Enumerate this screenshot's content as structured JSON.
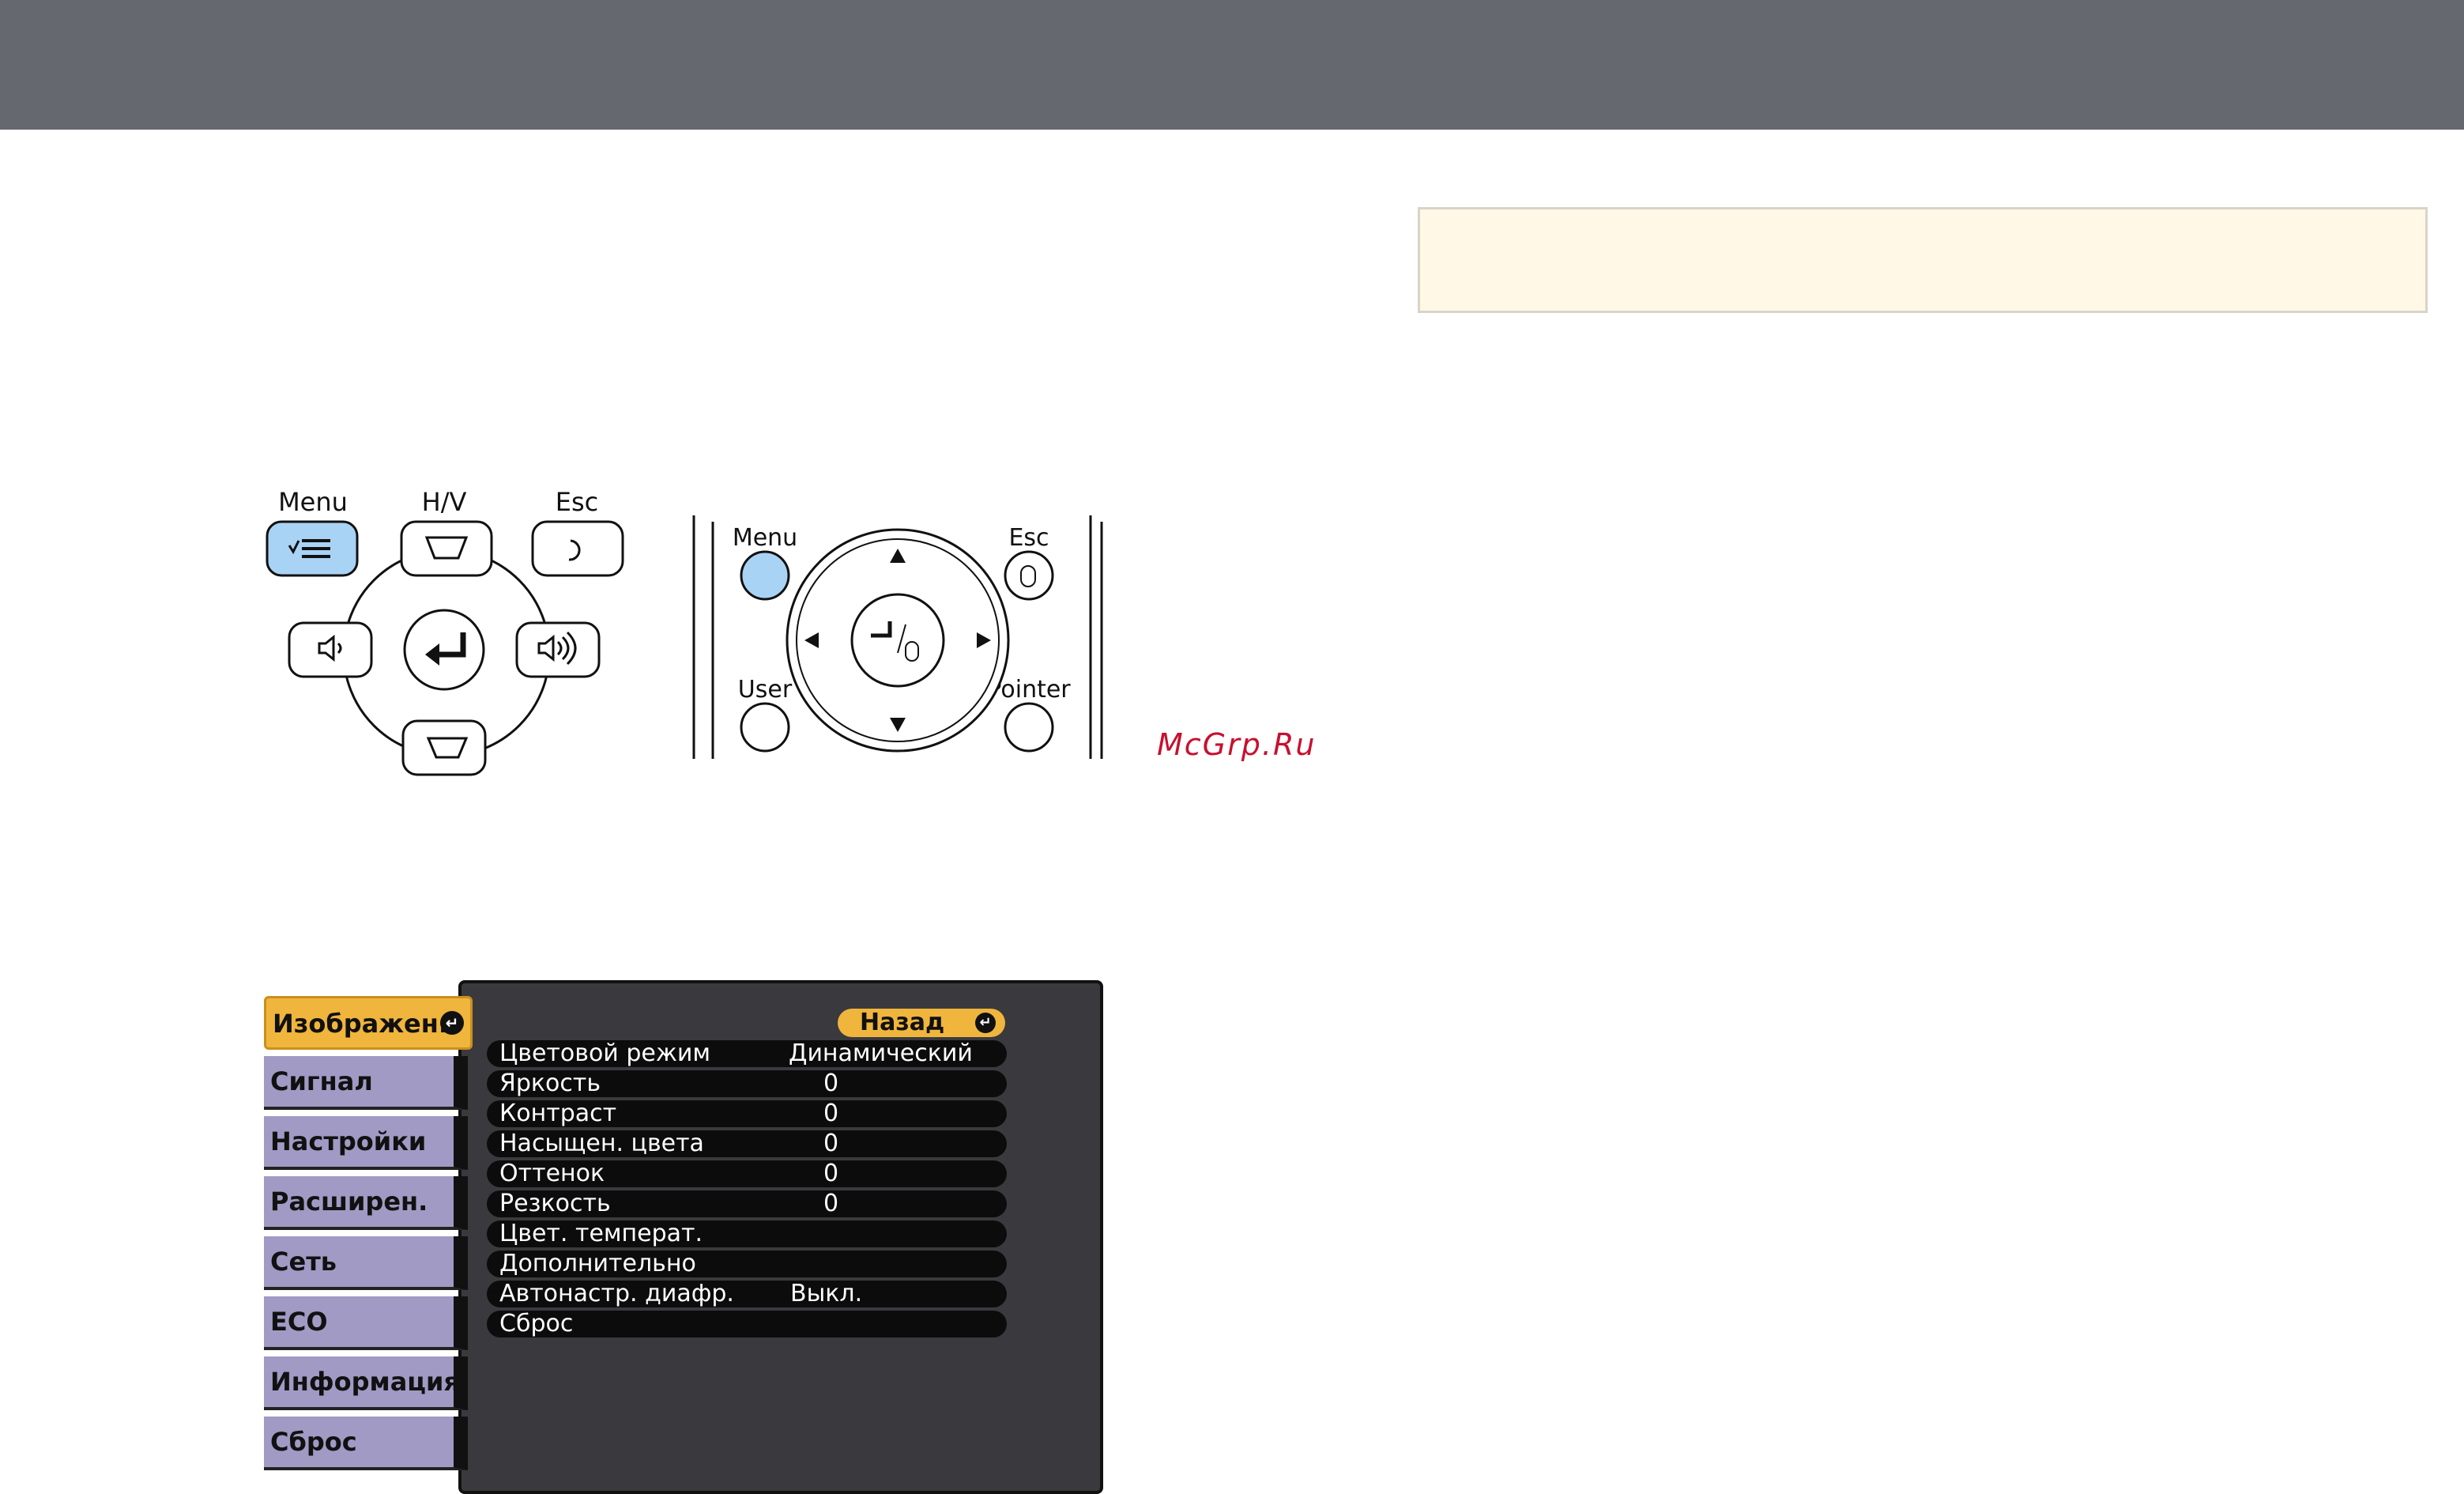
{
  "remote_left": {
    "menu_label": "Menu",
    "hv_label": "H/V",
    "esc_label": "Esc"
  },
  "remote_right": {
    "menu_label": "Menu",
    "esc_label": "Esc",
    "user_label": "User",
    "pointer_label": "Pointer"
  },
  "watermark": "McGrp.Ru",
  "osd": {
    "tabs": [
      {
        "label": "Изображен.",
        "active": true
      },
      {
        "label": "Сигнал"
      },
      {
        "label": "Настройки"
      },
      {
        "label": "Расширен."
      },
      {
        "label": "Сеть"
      },
      {
        "label": "ECO"
      },
      {
        "label": "Информация"
      },
      {
        "label": "Сброс"
      }
    ],
    "back_label": "Назад",
    "rows": [
      {
        "label": "Цветовой режим",
        "value": "Динамический"
      },
      {
        "label": "Яркость",
        "value": "0"
      },
      {
        "label": "Контраст",
        "value": "0"
      },
      {
        "label": "Насыщен. цвета",
        "value": "0"
      },
      {
        "label": "Оттенок",
        "value": "0"
      },
      {
        "label": "Резкость",
        "value": "0"
      },
      {
        "label": "Цвет. температ.",
        "value": ""
      },
      {
        "label": "Дополнительно",
        "value": ""
      },
      {
        "label": "Автонастр. диафр.",
        "value": "Выкл."
      },
      {
        "label": "Сброс",
        "value": ""
      }
    ]
  },
  "colors": {
    "header_bar": "#666870",
    "note_box": "#fff8e6",
    "menu_highlight": "#a9d3f5",
    "osd_tab": "#a09ac4",
    "osd_active": "#f0b53d",
    "watermark": "#c8102e"
  }
}
